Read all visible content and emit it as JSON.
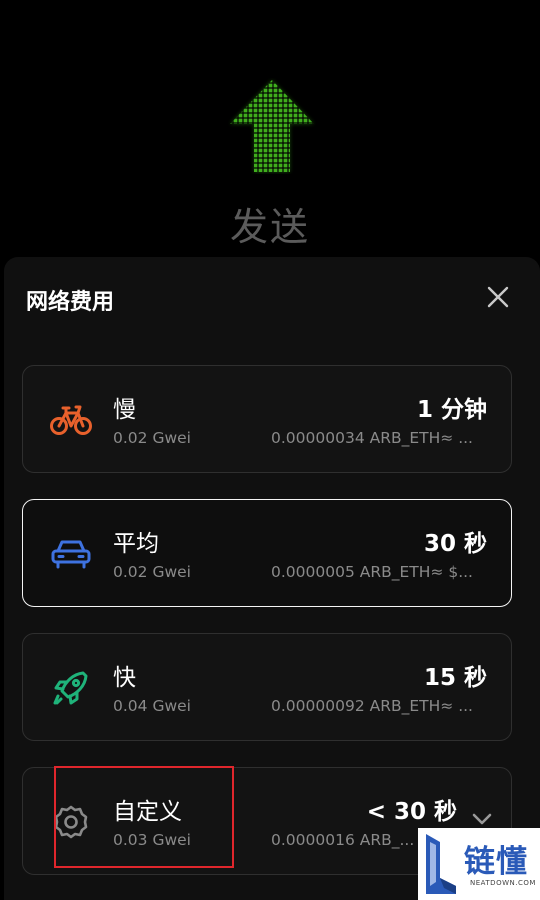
{
  "header": {
    "title": "发送",
    "arrow_icon": "up-arrow-icon",
    "arrow_color": "#3fae1d"
  },
  "sheet": {
    "title": "网络费用",
    "close_icon": "close-icon"
  },
  "options": [
    {
      "key": "slow",
      "name": "慢",
      "gwei": "0.02 Gwei",
      "time": "1 分钟",
      "amount": "0.00000034 ARB_ETH≈ ...",
      "icon": "bicycle-icon",
      "icon_color": "#e8612c",
      "selected": false
    },
    {
      "key": "average",
      "name": "平均",
      "gwei": "0.02 Gwei",
      "time": "30 秒",
      "amount": "0.0000005 ARB_ETH≈ $...",
      "icon": "car-icon",
      "icon_color": "#3e72e0",
      "selected": true
    },
    {
      "key": "fast",
      "name": "快",
      "gwei": "0.04 Gwei",
      "time": "15 秒",
      "amount": "0.00000092 ARB_ETH≈ ...",
      "icon": "rocket-icon",
      "icon_color": "#1fb37a",
      "selected": false
    },
    {
      "key": "custom",
      "name": "自定义",
      "gwei": "0.03 Gwei",
      "time": "< 30 秒",
      "amount": "0.0000016 ARB_...",
      "icon": "gear-icon",
      "icon_color": "#8a8a8a",
      "selected": false
    }
  ],
  "annotation": {
    "color": "#e0262c"
  },
  "watermark": {
    "text": "链懂",
    "sub": "NEATDOWN.COM"
  }
}
